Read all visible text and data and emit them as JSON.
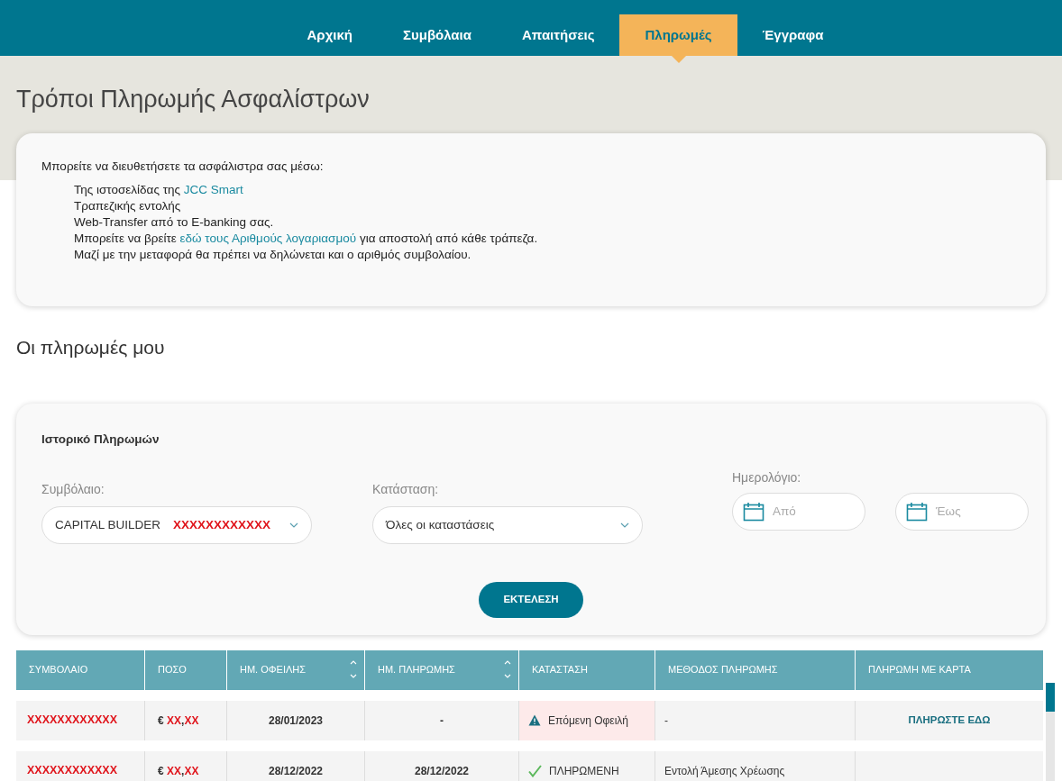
{
  "nav": {
    "tabs": [
      {
        "label": "Αρχική",
        "selected": false
      },
      {
        "label": "Συμβόλαια",
        "selected": false
      },
      {
        "label": "Απαιτήσεις",
        "selected": false
      },
      {
        "label": "Πληρωμές",
        "selected": true
      },
      {
        "label": "Έγγραφα",
        "selected": false
      }
    ]
  },
  "page_title": "Τρόποι Πληρωμής Ασφαλίστρων",
  "info": {
    "intro": "Μπορείτε να διευθετήσετε τα ασφάλιστρα σας μέσω:",
    "lines": [
      [
        {
          "text": "Της ιστοσελίδας της "
        },
        {
          "text": "JCC Smart",
          "link": true
        }
      ],
      [
        {
          "text": "Τραπεζικής εντολής"
        }
      ],
      [
        {
          "text": "Web-Transfer από το E-banking σας."
        }
      ],
      [
        {
          "text": "Μπορείτε να βρείτε "
        },
        {
          "text": "εδώ τους Αριθμούς λογαριασμού",
          "link": true
        },
        {
          "text": " για αποστολή από κάθε τράπεζα."
        }
      ],
      [
        {
          "text": "Μαζί με την μεταφορά θα πρέπει να δηλώνεται και ο αριθμός συμβολαίου."
        }
      ]
    ]
  },
  "section_title": "Οι πληρωμές μου",
  "filters": {
    "title": "Ιστορικό Πληρωμών",
    "contract": {
      "label": "Συμβόλαιο:",
      "value": "CAPITAL BUILDER",
      "masked": "XXXXXXXXXXXX"
    },
    "status": {
      "label": "Κατάσταση:",
      "value": "Όλες οι καταστάσεις"
    },
    "calendar": {
      "label": "Ημερολόγιο:",
      "from_placeholder": "Από",
      "to_placeholder": "Έως"
    },
    "run_button": "ΕΚΤΕΛΕΣΗ"
  },
  "table": {
    "columns": [
      {
        "label": "ΣΥΜΒΟΛΑΙΟ",
        "sortable": false
      },
      {
        "label": "ΠΟΣΟ",
        "sortable": false
      },
      {
        "label": "ΗΜ. ΟΦΕΙΛΗΣ",
        "sortable": true
      },
      {
        "label": "ΗΜ. ΠΛΗΡΩΜΗΣ",
        "sortable": true
      },
      {
        "label": "ΚΑΤΑΣΤΑΣΗ",
        "sortable": false
      },
      {
        "label": "ΜΕΘΟΔΟΣ ΠΛΗΡΩΜΗΣ",
        "sortable": false
      },
      {
        "label": "ΠΛΗΡΩΜΗ ΜΕ ΚΑΡΤΑ",
        "sortable": false
      }
    ],
    "rows": [
      {
        "contract": "XXXXXXXXXXXX",
        "currency": "€",
        "amount_int": "XX",
        "separator": ",",
        "amount_dec": "XX",
        "due_date": "28/01/2023",
        "payment_date": "-",
        "kind": "due",
        "status": "Επόμενη Οφειλή",
        "method": "-",
        "card_link": "ΠΛΗΡΩΣΤΕ ΕΔΩ"
      },
      {
        "contract": "XXXXXXXXXXXX",
        "currency": "€",
        "amount_int": "XX",
        "separator": ",",
        "amount_dec": "XX",
        "due_date": "28/12/2022",
        "payment_date": "28/12/2022",
        "kind": "paid",
        "status": "ΠΛΗΡΩΜΕΝΗ",
        "method": "Εντολή Άμεσης Χρέωσης"
      }
    ]
  }
}
